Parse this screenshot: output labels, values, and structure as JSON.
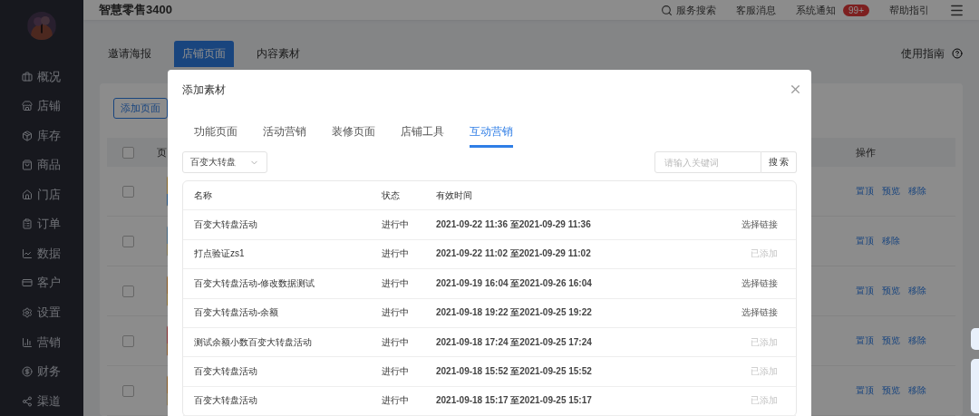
{
  "app": {
    "title": "智慧零售3400"
  },
  "header": {
    "search": "服务搜索",
    "links": [
      {
        "label": "客服消息"
      },
      {
        "label": "系统通知",
        "badge": "99+"
      },
      {
        "label": "帮助指引"
      }
    ]
  },
  "sidebar": {
    "items": [
      {
        "label": "概况"
      },
      {
        "label": "店铺"
      },
      {
        "label": "库存"
      },
      {
        "label": "商品"
      },
      {
        "label": "门店"
      },
      {
        "label": "订单"
      },
      {
        "label": "数据"
      },
      {
        "label": "客户"
      },
      {
        "label": "设置"
      },
      {
        "label": "营销"
      },
      {
        "label": "财务"
      },
      {
        "label": "渠道"
      }
    ]
  },
  "page": {
    "tabs": [
      {
        "label": "邀请海报",
        "selected": false
      },
      {
        "label": "店铺页面",
        "selected": true
      },
      {
        "label": "内容素材",
        "selected": false
      }
    ],
    "guide": "使用指南",
    "add_button": "添加页面",
    "table": {
      "header_checked": false,
      "columns": [
        "页",
        "操作"
      ],
      "rows": [
        {
          "checked": false,
          "actions": [
            "置顶",
            "预览",
            "移除"
          ]
        },
        {
          "checked": false,
          "actions": [
            "置顶",
            "移除"
          ]
        },
        {
          "checked": false,
          "actions": [
            "置顶",
            "预览",
            "移除"
          ]
        },
        {
          "checked": false,
          "actions": [
            "置顶",
            "预览",
            "移除"
          ]
        },
        {
          "checked": false,
          "actions": [
            "置顶",
            "预览",
            "移除"
          ]
        }
      ]
    }
  },
  "dialog": {
    "title": "添加素材",
    "tabs": [
      {
        "label": "功能页面",
        "selected": false
      },
      {
        "label": "活动营销",
        "selected": false
      },
      {
        "label": "装修页面",
        "selected": false
      },
      {
        "label": "店铺工具",
        "selected": false
      },
      {
        "label": "互动营销",
        "selected": true
      }
    ],
    "type_select": "百变大转盘",
    "search": {
      "placeholder": "请输入关键词",
      "button": "搜 索"
    },
    "table": {
      "columns": [
        "名称",
        "状态",
        "有效时间"
      ],
      "rows": [
        {
          "name": "百变大转盘活动",
          "status": "进行中",
          "time": "2021-09-22 11:36 至2021-09-29 11:36",
          "action": "选择链接",
          "added": false
        },
        {
          "name": "打点验证zs1",
          "status": "进行中",
          "time": "2021-09-22 11:02 至2021-09-29 11:02",
          "action": "已添加",
          "added": true
        },
        {
          "name": "百变大转盘活动-修改数据测试",
          "status": "进行中",
          "time": "2021-09-19 16:04 至2021-09-26 16:04",
          "action": "选择链接",
          "added": false
        },
        {
          "name": "百变大转盘活动-余额",
          "status": "进行中",
          "time": "2021-09-18 19:22 至2021-09-25 19:22",
          "action": "选择链接",
          "added": false
        },
        {
          "name": "测试余额小数百变大转盘活动",
          "status": "进行中",
          "time": "2021-09-18 17:24 至2021-09-25 17:24",
          "action": "已添加",
          "added": true
        },
        {
          "name": "百变大转盘活动",
          "status": "进行中",
          "time": "2021-09-18 15:52 至2021-09-25 15:52",
          "action": "已添加",
          "added": true
        },
        {
          "name": "百变大转盘活动",
          "status": "进行中",
          "time": "2021-09-18 15:17 至2021-09-25 15:17",
          "action": "已添加",
          "added": true
        }
      ]
    }
  }
}
